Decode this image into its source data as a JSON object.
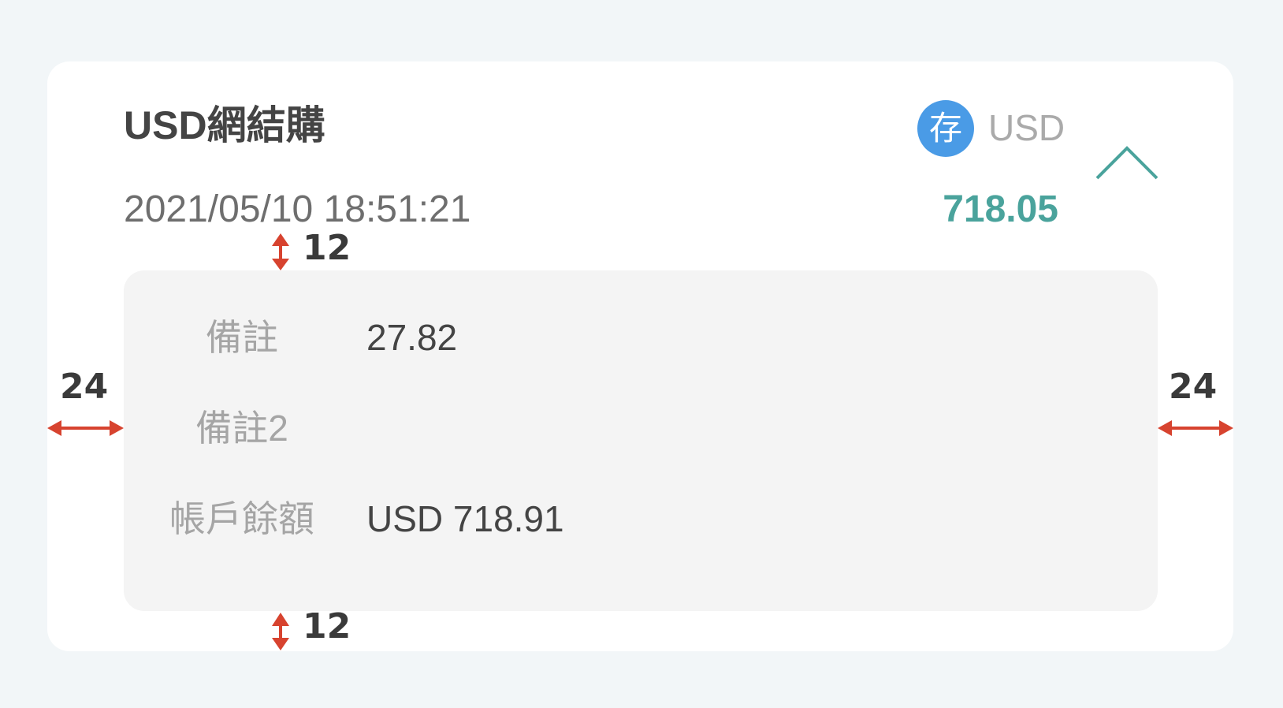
{
  "transaction": {
    "title": "USD網結購",
    "datetime": "2021/05/10 18:51:21",
    "badge_glyph": "存",
    "currency": "USD",
    "amount": "718.05",
    "colors": {
      "amount": "#4aa39c",
      "badge": "#4a9be6",
      "chevron": "#4aa39c"
    }
  },
  "details": {
    "rows": [
      {
        "label": "備註",
        "value": "27.82"
      },
      {
        "label": "備註2",
        "value": ""
      },
      {
        "label": "帳戶餘額",
        "value": "USD 718.91"
      }
    ]
  },
  "spacing_annotations": {
    "top_gap": "12",
    "bottom_gap": "12",
    "left_margin": "24",
    "right_margin": "24",
    "arrow_color": "#d7432f"
  },
  "icons": {
    "collapse": "chevron-up-icon"
  }
}
